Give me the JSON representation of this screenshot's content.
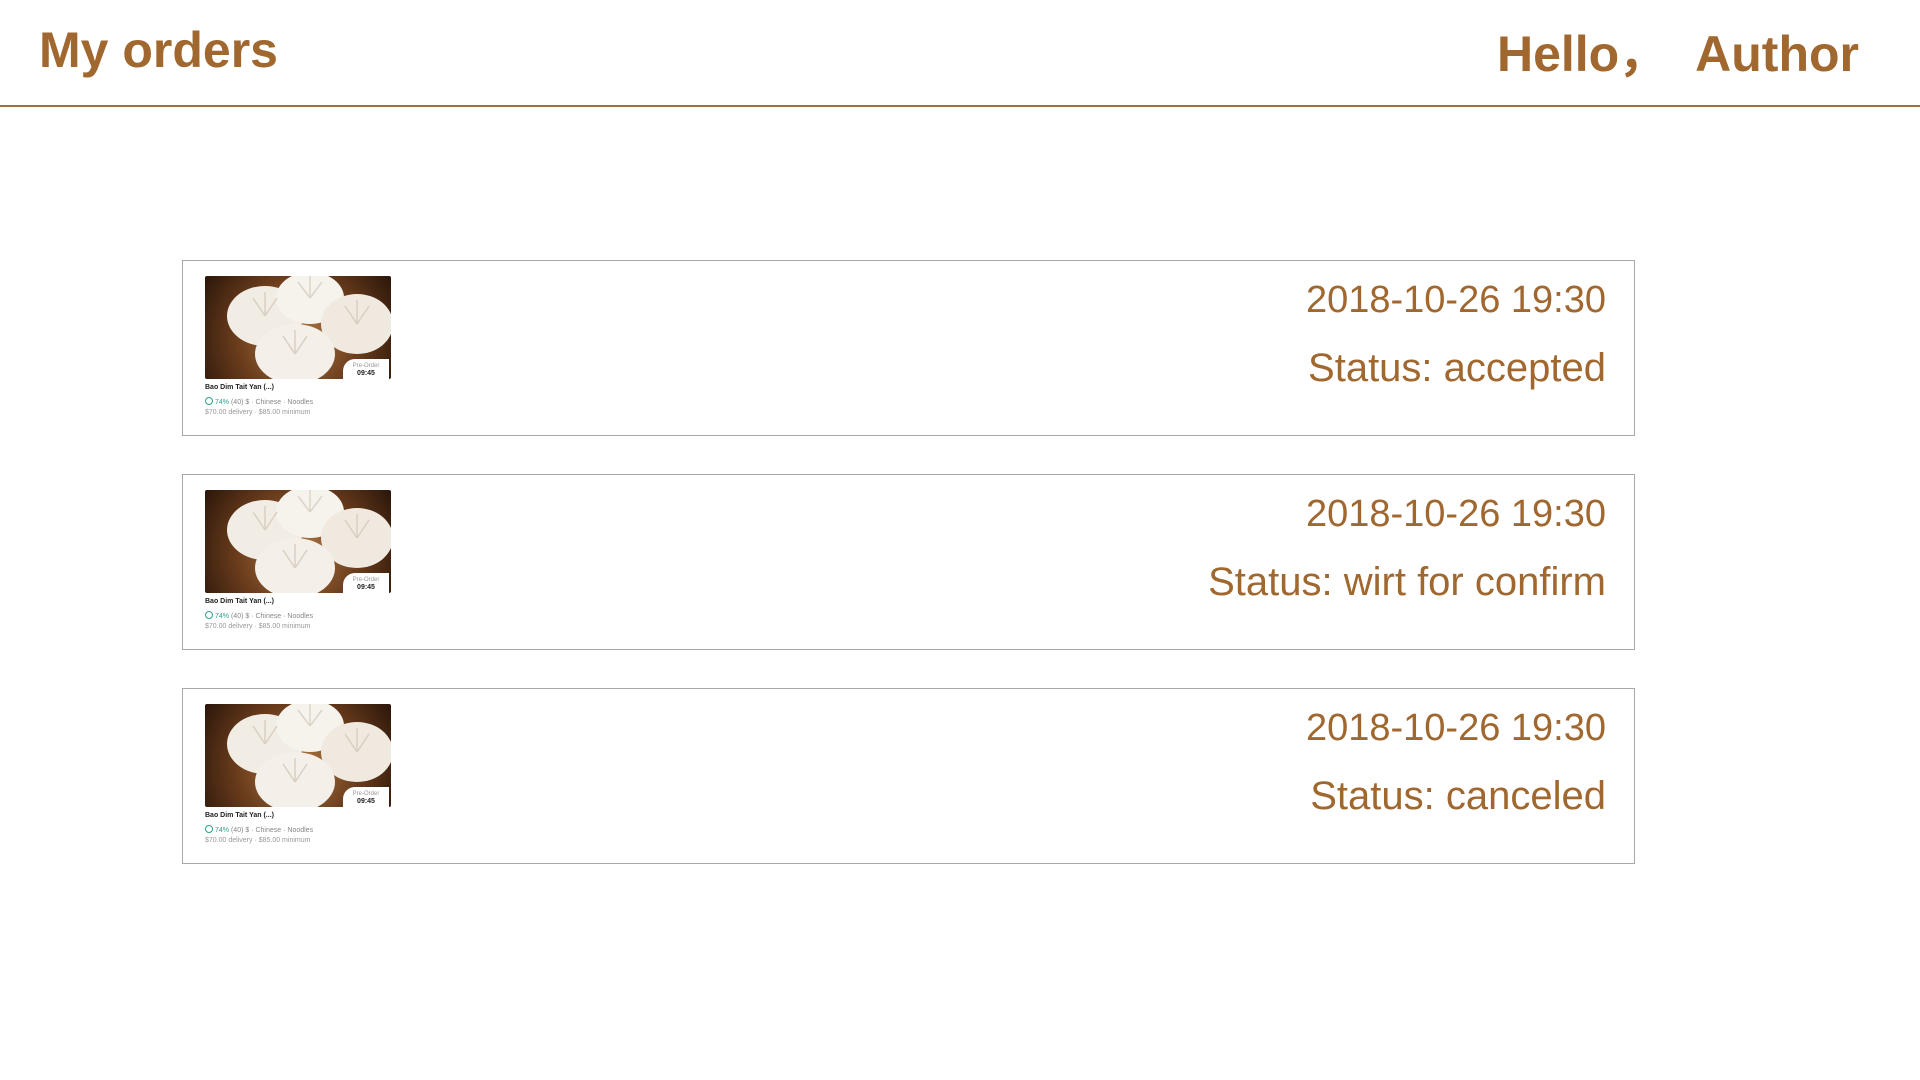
{
  "header": {
    "title": "My orders",
    "greeting": "Hello，  Author"
  },
  "orders": [
    {
      "datetime": "2018-10-26 19:30",
      "status": "Status: accepted",
      "restaurant": {
        "name": "Bao Dim Tait Yan (...)",
        "rating": "74%",
        "rating_count": "(40)",
        "meta": "$ · Chinese · Noodles",
        "fees": "$70.00 delivery · $85.00 minimum",
        "preorder_label": "Pre-Order",
        "preorder_time": "09:45"
      }
    },
    {
      "datetime": "2018-10-26 19:30",
      "status": "Status: wirt for confirm",
      "restaurant": {
        "name": "Bao Dim Tait Yan (...)",
        "rating": "74%",
        "rating_count": "(40)",
        "meta": "$ · Chinese · Noodles",
        "fees": "$70.00 delivery · $85.00 minimum",
        "preorder_label": "Pre-Order",
        "preorder_time": "09:45"
      }
    },
    {
      "datetime": "2018-10-26 19:30",
      "status": "Status: canceled",
      "restaurant": {
        "name": "Bao Dim Tait Yan (...)",
        "rating": "74%",
        "rating_count": "(40)",
        "meta": "$ · Chinese · Noodles",
        "fees": "$70.00 delivery · $85.00 minimum",
        "preorder_label": "Pre-Order",
        "preorder_time": "09:45"
      }
    }
  ],
  "colors": {
    "accent": "#a0672f",
    "divider": "#a0703a",
    "card_border": "#a8a8a8",
    "rating_green": "#2aa38b"
  }
}
